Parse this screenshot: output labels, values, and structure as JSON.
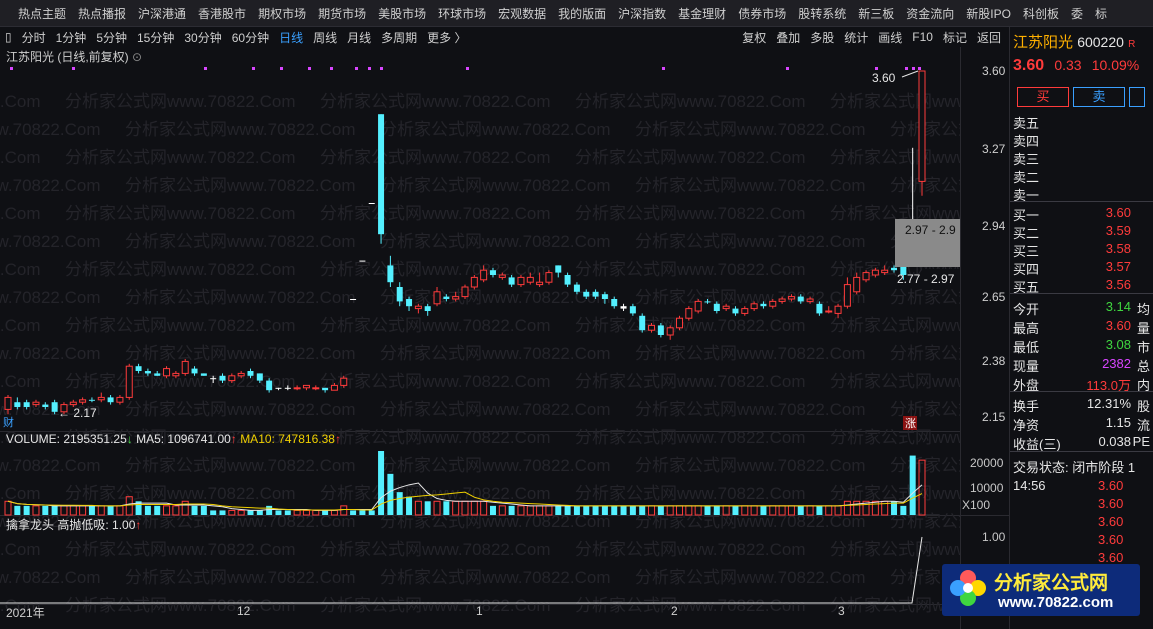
{
  "nav": [
    "热点主题",
    "热点播报",
    "沪深港通",
    "香港股市",
    "期权市场",
    "期货市场",
    "美股市场",
    "环球市场",
    "宏观数据",
    "我的版面",
    "沪深指数",
    "基金理财",
    "债券市场",
    "股转系统",
    "新三板",
    "资金流向",
    "新股IPO",
    "科创板",
    "委",
    "标"
  ],
  "toolbar": {
    "periods": [
      "分时",
      "1分钟",
      "5分钟",
      "15分钟",
      "30分钟",
      "60分钟",
      "日线",
      "周线",
      "月线",
      "多周期",
      "更多 〉"
    ],
    "active": "日线",
    "right": [
      "复权",
      "叠加",
      "多股",
      "统计",
      "画线",
      "F10",
      "标记",
      "返回"
    ]
  },
  "chart_title": "江苏阳光 (日线,前复权)",
  "price_axis": [
    "3.60",
    "3.27",
    "2.94",
    "2.65",
    "2.38",
    "2.15"
  ],
  "annotations": {
    "high": "3.60",
    "low": "2.17",
    "box1": "2.97 - 2.9",
    "box2": "2.77 - 2.97",
    "cai": "财",
    "zhang": "涨"
  },
  "volume": {
    "label": "VOLUME: 2195351.25",
    "ma5": "MA5: 1096741.00",
    "ma10": "MA10: 747816.38",
    "axis": [
      "20000",
      "10000",
      "X100"
    ]
  },
  "indicator": {
    "label": "擒拿龙头",
    "value": "高抛低吸: 1.00",
    "axis": "1.00"
  },
  "date_axis": [
    "2021年",
    "12",
    "1",
    "2",
    "3"
  ],
  "watermark": "分析家公式网www.70822.Com",
  "right_panel": {
    "name": "江苏阳光",
    "code": "600220",
    "r": "R",
    "price": "3.60",
    "change": "0.33",
    "pct": "10.09%",
    "buy_btn": "买",
    "sell_btn": "卖",
    "sells": [
      "卖五",
      "卖四",
      "卖三",
      "卖二",
      "卖一"
    ],
    "buys": [
      {
        "label": "买一",
        "v": "3.60"
      },
      {
        "label": "买二",
        "v": "3.59"
      },
      {
        "label": "买三",
        "v": "3.58"
      },
      {
        "label": "买四",
        "v": "3.57"
      },
      {
        "label": "买五",
        "v": "3.56"
      }
    ],
    "stats": [
      {
        "label": "今开",
        "v": "3.14",
        "s": "均",
        "c": "green"
      },
      {
        "label": "最高",
        "v": "3.60",
        "s": "量",
        "c": "red"
      },
      {
        "label": "最低",
        "v": "3.08",
        "s": "市",
        "c": "green"
      },
      {
        "label": "现量",
        "v": "2382",
        "s": "总",
        "c": "purple"
      },
      {
        "label": "外盘",
        "v": "113.0万",
        "s": "内",
        "c": "red"
      }
    ],
    "stats2": [
      {
        "label": "换手",
        "v": "12.31%",
        "s": "股"
      },
      {
        "label": "净资",
        "v": "1.15",
        "s": "流"
      },
      {
        "label": "收益(三)",
        "v": "0.038",
        "s": "PE"
      }
    ],
    "trade_status": "交易状态: 闭市阶段 1",
    "time": "14:56",
    "ticks": [
      "3.60",
      "3.60",
      "3.60",
      "3.60",
      "3.60",
      "3.60"
    ]
  },
  "logo": {
    "text": "分析家公式网",
    "url": "www.70822.com"
  },
  "chart_data": {
    "type": "candlestick",
    "price_range": [
      2.15,
      3.6
    ],
    "candles": [
      [
        2.24,
        2.19,
        2.25,
        2.17,
        "r"
      ],
      [
        2.2,
        2.22,
        2.24,
        2.19,
        "c"
      ],
      [
        2.22,
        2.2,
        2.23,
        2.19,
        "c"
      ],
      [
        2.21,
        2.22,
        2.23,
        2.2,
        "r"
      ],
      [
        2.2,
        2.21,
        2.22,
        2.19,
        "c"
      ],
      [
        2.22,
        2.18,
        2.23,
        2.17,
        "c"
      ],
      [
        2.18,
        2.21,
        2.22,
        2.17,
        "r"
      ],
      [
        2.21,
        2.22,
        2.23,
        2.2,
        "r"
      ],
      [
        2.22,
        2.23,
        2.24,
        2.21,
        "r"
      ],
      [
        2.23,
        2.23,
        2.24,
        2.22,
        "c"
      ],
      [
        2.23,
        2.24,
        2.26,
        2.22,
        "r"
      ],
      [
        2.24,
        2.22,
        2.25,
        2.21,
        "c"
      ],
      [
        2.22,
        2.24,
        2.25,
        2.21,
        "r"
      ],
      [
        2.24,
        2.37,
        2.38,
        2.23,
        "r"
      ],
      [
        2.37,
        2.35,
        2.38,
        2.34,
        "c"
      ],
      [
        2.35,
        2.34,
        2.36,
        2.33,
        "c"
      ],
      [
        2.34,
        2.33,
        2.35,
        2.33,
        "c"
      ],
      [
        2.33,
        2.36,
        2.37,
        2.32,
        "r"
      ],
      [
        2.33,
        2.34,
        2.35,
        2.32,
        "r"
      ],
      [
        2.34,
        2.39,
        2.4,
        2.33,
        "r"
      ],
      [
        2.36,
        2.34,
        2.37,
        2.33,
        "c"
      ],
      [
        2.34,
        2.33,
        2.34,
        2.33,
        "c"
      ],
      [
        2.32,
        2.32,
        2.33,
        2.3,
        "w"
      ],
      [
        2.33,
        2.31,
        2.34,
        2.3,
        "c"
      ],
      [
        2.31,
        2.33,
        2.34,
        2.3,
        "r"
      ],
      [
        2.33,
        2.34,
        2.35,
        2.32,
        "r"
      ],
      [
        2.35,
        2.33,
        2.36,
        2.32,
        "c"
      ],
      [
        2.34,
        2.31,
        2.34,
        2.3,
        "c"
      ],
      [
        2.31,
        2.27,
        2.32,
        2.26,
        "c"
      ],
      [
        2.28,
        2.28,
        2.28,
        2.27,
        "w"
      ],
      [
        2.28,
        2.28,
        2.29,
        2.27,
        "w"
      ],
      [
        2.28,
        2.28,
        2.29,
        2.27,
        "r"
      ],
      [
        2.28,
        2.29,
        2.29,
        2.27,
        "r"
      ],
      [
        2.28,
        2.28,
        2.29,
        2.27,
        "r"
      ],
      [
        2.28,
        2.27,
        2.28,
        2.26,
        "c"
      ],
      [
        2.27,
        2.29,
        2.3,
        2.27,
        "r"
      ],
      [
        2.29,
        2.32,
        2.33,
        2.28,
        "r"
      ],
      [
        2.65,
        2.65,
        2.65,
        2.65,
        "w"
      ],
      [
        2.81,
        2.81,
        2.81,
        2.81,
        "w"
      ],
      [
        3.05,
        3.05,
        3.05,
        3.05,
        "w"
      ],
      [
        3.42,
        2.92,
        3.42,
        2.88,
        "c"
      ],
      [
        2.79,
        2.72,
        2.83,
        2.7,
        "c"
      ],
      [
        2.7,
        2.64,
        2.72,
        2.62,
        "c"
      ],
      [
        2.65,
        2.62,
        2.66,
        2.6,
        "c"
      ],
      [
        2.62,
        2.61,
        2.63,
        2.59,
        "r"
      ],
      [
        2.62,
        2.6,
        2.63,
        2.58,
        "c"
      ],
      [
        2.63,
        2.68,
        2.7,
        2.62,
        "r"
      ],
      [
        2.66,
        2.65,
        2.67,
        2.64,
        "c"
      ],
      [
        2.65,
        2.66,
        2.68,
        2.64,
        "r"
      ],
      [
        2.66,
        2.7,
        2.71,
        2.65,
        "r"
      ],
      [
        2.7,
        2.74,
        2.75,
        2.69,
        "r"
      ],
      [
        2.73,
        2.77,
        2.79,
        2.72,
        "r"
      ],
      [
        2.77,
        2.75,
        2.78,
        2.74,
        "c"
      ],
      [
        2.74,
        2.75,
        2.76,
        2.73,
        "r"
      ],
      [
        2.74,
        2.71,
        2.75,
        2.7,
        "c"
      ],
      [
        2.71,
        2.74,
        2.75,
        2.7,
        "r"
      ],
      [
        2.74,
        2.72,
        2.76,
        2.71,
        "r"
      ],
      [
        2.71,
        2.72,
        2.76,
        2.7,
        "r"
      ],
      [
        2.72,
        2.76,
        2.77,
        2.71,
        "r"
      ],
      [
        2.76,
        2.79,
        2.79,
        2.74,
        "c"
      ],
      [
        2.75,
        2.71,
        2.76,
        2.7,
        "c"
      ],
      [
        2.71,
        2.68,
        2.72,
        2.67,
        "c"
      ],
      [
        2.68,
        2.66,
        2.69,
        2.65,
        "c"
      ],
      [
        2.66,
        2.68,
        2.69,
        2.65,
        "c"
      ],
      [
        2.67,
        2.65,
        2.68,
        2.63,
        "c"
      ],
      [
        2.65,
        2.62,
        2.66,
        2.61,
        "c"
      ],
      [
        2.62,
        2.61,
        2.63,
        2.6,
        "w"
      ],
      [
        2.62,
        2.59,
        2.63,
        2.58,
        "c"
      ],
      [
        2.58,
        2.52,
        2.59,
        2.51,
        "c"
      ],
      [
        2.52,
        2.54,
        2.55,
        2.51,
        "r"
      ],
      [
        2.54,
        2.5,
        2.55,
        2.49,
        "c"
      ],
      [
        2.5,
        2.53,
        2.54,
        2.48,
        "r"
      ],
      [
        2.53,
        2.57,
        2.58,
        2.52,
        "r"
      ],
      [
        2.57,
        2.61,
        2.62,
        2.56,
        "r"
      ],
      [
        2.6,
        2.64,
        2.65,
        2.59,
        "r"
      ],
      [
        2.64,
        2.64,
        2.65,
        2.63,
        "c"
      ],
      [
        2.63,
        2.6,
        2.64,
        2.59,
        "c"
      ],
      [
        2.61,
        2.62,
        2.63,
        2.6,
        "r"
      ],
      [
        2.61,
        2.59,
        2.62,
        2.58,
        "c"
      ],
      [
        2.59,
        2.61,
        2.62,
        2.58,
        "r"
      ],
      [
        2.61,
        2.63,
        2.64,
        2.6,
        "r"
      ],
      [
        2.63,
        2.62,
        2.64,
        2.61,
        "c"
      ],
      [
        2.62,
        2.64,
        2.65,
        2.61,
        "r"
      ],
      [
        2.64,
        2.65,
        2.66,
        2.63,
        "r"
      ],
      [
        2.65,
        2.66,
        2.67,
        2.64,
        "r"
      ],
      [
        2.66,
        2.64,
        2.67,
        2.63,
        "c"
      ],
      [
        2.64,
        2.65,
        2.66,
        2.63,
        "r"
      ],
      [
        2.63,
        2.59,
        2.64,
        2.58,
        "c"
      ],
      [
        2.6,
        2.6,
        2.62,
        2.59,
        "r"
      ],
      [
        2.59,
        2.62,
        2.63,
        2.57,
        "r"
      ],
      [
        2.62,
        2.71,
        2.74,
        2.61,
        "r"
      ],
      [
        2.68,
        2.74,
        2.76,
        2.67,
        "r"
      ],
      [
        2.73,
        2.76,
        2.77,
        2.72,
        "r"
      ],
      [
        2.75,
        2.77,
        2.78,
        2.74,
        "r"
      ],
      [
        2.77,
        2.76,
        2.79,
        2.75,
        "r"
      ],
      [
        2.77,
        2.78,
        2.79,
        2.76,
        "c"
      ],
      [
        2.79,
        2.75,
        2.8,
        2.73,
        "c"
      ],
      [
        2.97,
        2.97,
        3.28,
        2.96,
        "w"
      ],
      [
        3.14,
        3.6,
        3.6,
        3.08,
        "r"
      ]
    ],
    "volumes": [
      3,
      2,
      2,
      2,
      2,
      2,
      2,
      2,
      2,
      2,
      2,
      2,
      2,
      4,
      3,
      2,
      2,
      2,
      2,
      3,
      2,
      2,
      1,
      1,
      1,
      1,
      1,
      1,
      2,
      1,
      1,
      1,
      1,
      1,
      1,
      1,
      2,
      1,
      1,
      1,
      14,
      9,
      5,
      4,
      3,
      3,
      3,
      3,
      3,
      3,
      3,
      3,
      2,
      2,
      2,
      2,
      2,
      2,
      2,
      2,
      2,
      2,
      2,
      2,
      2,
      2,
      2,
      2,
      2,
      2,
      2,
      2,
      2,
      2,
      2,
      2,
      2,
      2,
      2,
      2,
      2,
      2,
      2,
      2,
      2,
      2,
      2,
      2,
      2,
      2,
      3,
      3,
      3,
      3,
      3,
      3,
      2,
      13,
      12
    ]
  }
}
